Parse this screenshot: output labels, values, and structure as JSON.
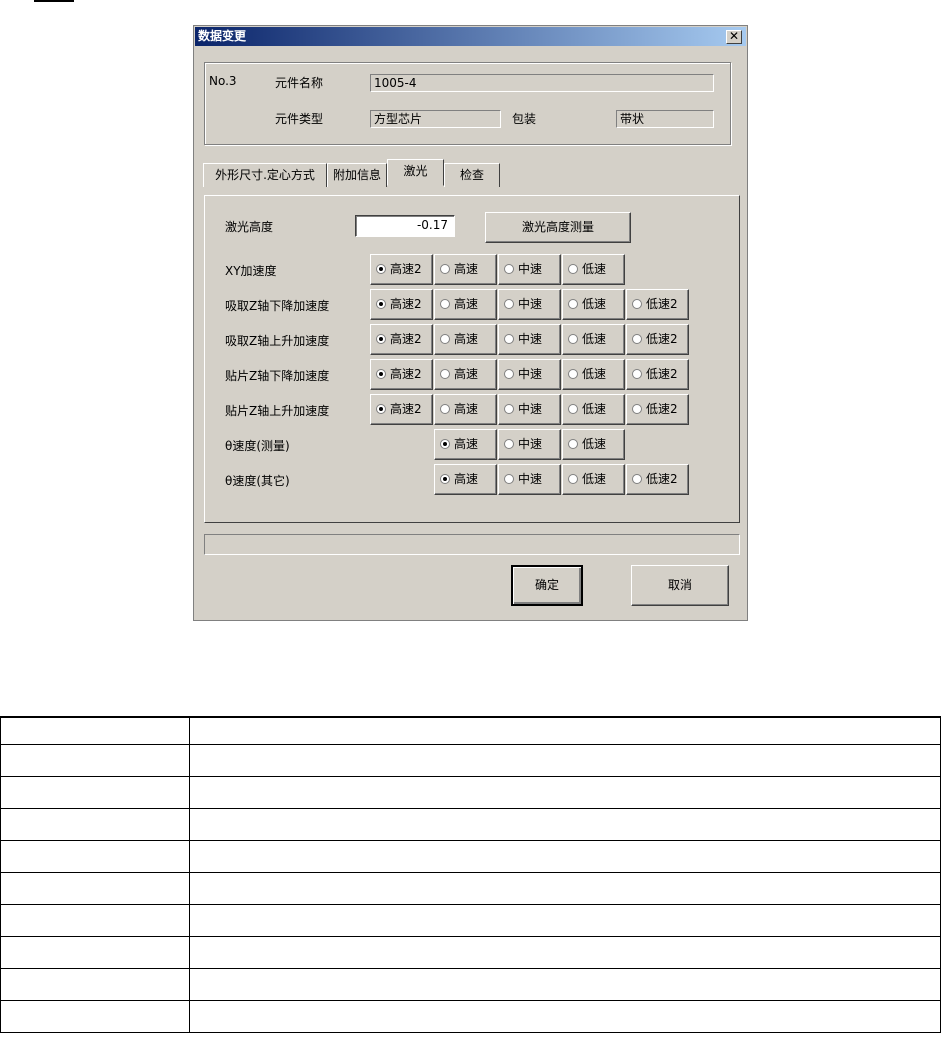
{
  "dialog": {
    "title": "数据变更",
    "close_glyph": "✕",
    "info": {
      "number": "No.3",
      "part_name_label": "元件名称",
      "part_name_value": "1005-4",
      "part_type_label": "元件类型",
      "part_type_value": "方型芯片",
      "package_label": "包装",
      "package_value": "带状"
    },
    "tabs": [
      {
        "label": "外形尺寸.定心方式"
      },
      {
        "label": "附加信息"
      },
      {
        "label": "激光"
      },
      {
        "label": "检查"
      }
    ],
    "laser": {
      "height_label": "激光高度",
      "height_value": "-0.17",
      "measure_button": "激光高度测量"
    },
    "speed_rows": [
      {
        "label": "XY加速度",
        "options": [
          "高速2",
          "高速",
          "中速",
          "低速"
        ],
        "selected": 0
      },
      {
        "label": "吸取Z轴下降加速度",
        "options": [
          "高速2",
          "高速",
          "中速",
          "低速",
          "低速2"
        ],
        "selected": 0
      },
      {
        "label": "吸取Z轴上升加速度",
        "options": [
          "高速2",
          "高速",
          "中速",
          "低速",
          "低速2"
        ],
        "selected": 0
      },
      {
        "label": "贴片Z轴下降加速度",
        "options": [
          "高速2",
          "高速",
          "中速",
          "低速",
          "低速2"
        ],
        "selected": 0
      },
      {
        "label": "贴片Z轴上升加速度",
        "options": [
          "高速2",
          "高速",
          "中速",
          "低速",
          "低速2"
        ],
        "selected": 0
      },
      {
        "label": "θ速度(测量)",
        "options": [
          "高速",
          "中速",
          "低速"
        ],
        "selected": 0
      },
      {
        "label": "θ速度(其它)",
        "options": [
          "高速",
          "中速",
          "低速",
          "低速2"
        ],
        "selected": 0
      }
    ],
    "ok_label": "确定",
    "cancel_label": "取消"
  },
  "table_rows": 10
}
